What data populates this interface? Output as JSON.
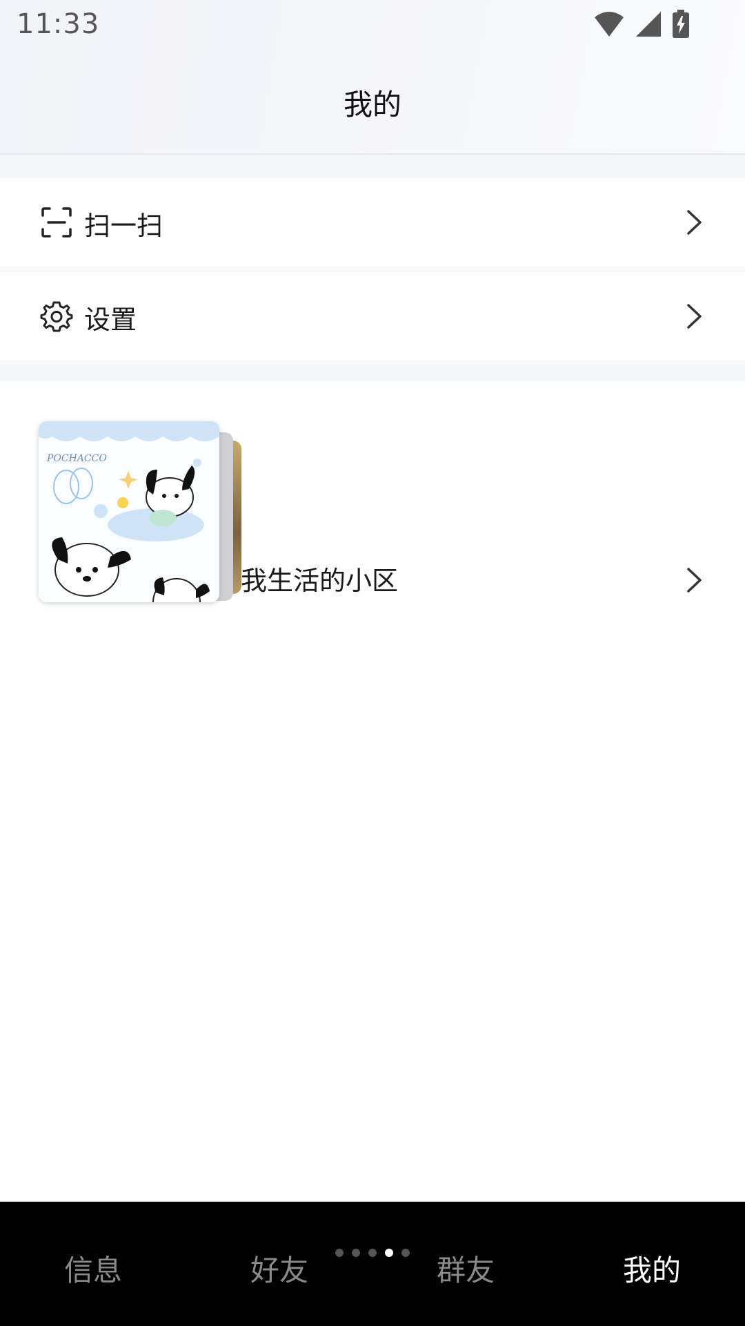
{
  "status_bar": {
    "time": "11:33",
    "icons": [
      "wifi-icon",
      "signal-icon",
      "battery-charging-icon"
    ]
  },
  "header": {
    "title": "我的"
  },
  "menu": [
    {
      "icon": "scan-icon",
      "label": "扫一扫"
    },
    {
      "icon": "gear-icon",
      "label": "设置"
    }
  ],
  "community": {
    "label": "我生活的小区",
    "image_text": "POCHACCO"
  },
  "pager": {
    "count": 5,
    "active_index": 3
  },
  "tabs": [
    {
      "label": "信息",
      "active": false
    },
    {
      "label": "好友",
      "active": false
    },
    {
      "label": "群友",
      "active": false
    },
    {
      "label": "我的",
      "active": true
    }
  ],
  "colors": {
    "tab_bar_bg": "#000000",
    "tab_active": "#ffffff",
    "tab_inactive": "#8a8a8a"
  }
}
